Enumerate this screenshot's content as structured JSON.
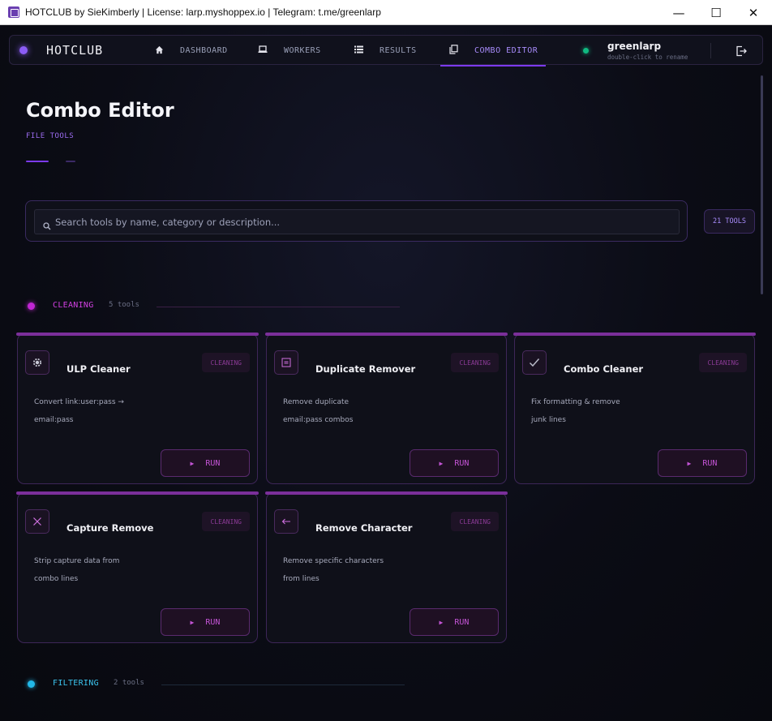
{
  "window": {
    "title": "HOTCLUB by SieKimberly | License: larp.myshoppex.io | Telegram: t.me/greenlarp",
    "minimize": "—",
    "maximize": "☐",
    "close": "✕"
  },
  "nav": {
    "brand": "HOTCLUB",
    "items": [
      {
        "label": "DASHBOARD",
        "icon": "home-icon"
      },
      {
        "label": "WORKERS",
        "icon": "laptop-icon"
      },
      {
        "label": "RESULTS",
        "icon": "list-icon"
      },
      {
        "label": "COMBO EDITOR",
        "icon": "copy-icon",
        "active": true
      }
    ],
    "user": {
      "name": "greenlarp",
      "hint": "double-click to rename",
      "status_color": "#10b981"
    }
  },
  "page": {
    "title": "Combo Editor",
    "subtitle": "FILE TOOLS"
  },
  "search": {
    "placeholder": "Search tools by name, category or description...",
    "value": ""
  },
  "tool_count": "21 TOOLS",
  "sections": [
    {
      "name": "CLEANING",
      "count": "5 tools",
      "color": "#c026d3"
    },
    {
      "name": "FILTERING",
      "count": "2 tools",
      "color": "#22b8e8"
    }
  ],
  "cards": [
    {
      "title": "ULP Cleaner",
      "tag": "CLEANING",
      "desc_line1": "Convert link:user:pass →",
      "desc_line2": "email:pass",
      "run": "RUN",
      "icon": "gear-icon"
    },
    {
      "title": "Duplicate Remover",
      "tag": "CLEANING",
      "desc_line1": "Remove duplicate",
      "desc_line2": "email:pass combos",
      "run": "RUN",
      "icon": "duplicate-icon"
    },
    {
      "title": "Combo Cleaner",
      "tag": "CLEANING",
      "desc_line1": "Fix formatting & remove",
      "desc_line2": "junk lines",
      "run": "RUN",
      "icon": "check-icon"
    },
    {
      "title": "Capture Remove",
      "tag": "CLEANING",
      "desc_line1": "Strip capture data from",
      "desc_line2": "combo lines",
      "run": "RUN",
      "icon": "x-icon"
    },
    {
      "title": "Remove Character",
      "tag": "CLEANING",
      "desc_line1": "Remove specific characters",
      "desc_line2": "from lines",
      "run": "RUN",
      "icon": "arrow-left-icon"
    }
  ],
  "colors": {
    "accent": "#7c3aed",
    "card_accent": "#7b2f9a",
    "run_text": "#c454d6"
  }
}
